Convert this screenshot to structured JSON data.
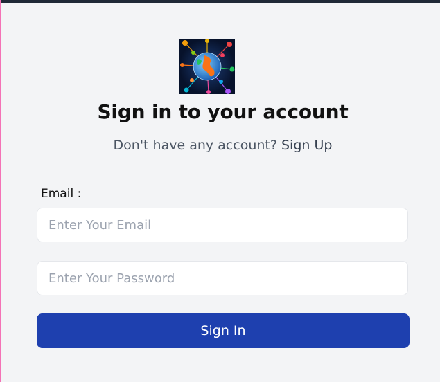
{
  "header": {
    "title": "Sign in to your account",
    "signup_prompt": "Don't have any account?",
    "signup_link": "Sign Up"
  },
  "logo": {
    "icon": "globe-network-icon"
  },
  "form": {
    "email_label": "Email :",
    "email_placeholder": "Enter Your Email",
    "password_placeholder": "Enter Your Password",
    "submit_label": "Sign In"
  },
  "colors": {
    "background": "#f3f4f6",
    "top_bar": "#1f2937",
    "left_edge": "#f472b6",
    "button": "#1e40af",
    "title_text": "#111111",
    "muted_text": "#4b5563"
  }
}
